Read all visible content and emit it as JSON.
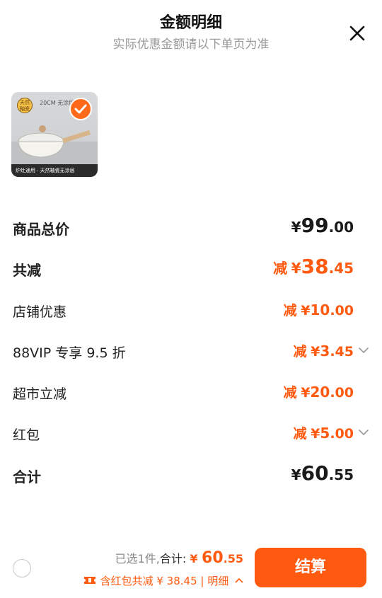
{
  "header": {
    "title": "金额明细",
    "subtitle": "实际优惠金额请以下单页为准"
  },
  "product": {
    "badge_text": "天然釉瓷",
    "size_text": "20CM 无涂层",
    "caption": "炉灶通用 · 天然釉瓷无涂层"
  },
  "rows": [
    {
      "label": "商品总价",
      "prefix": "",
      "currency": "¥",
      "integer": "99",
      "decimal": ".00"
    },
    {
      "label": "共减",
      "prefix": "减",
      "currency": "¥",
      "integer": "38",
      "decimal": ".45"
    },
    {
      "label": "店铺优惠",
      "prefix": "减",
      "currency": "¥",
      "integer": "10",
      "decimal": ".00"
    },
    {
      "label": "88VIP 专享 9.5 折",
      "prefix": "减",
      "currency": "¥",
      "integer": "3",
      "decimal": ".45"
    },
    {
      "label": "超市立减",
      "prefix": "减",
      "currency": "¥",
      "integer": "20",
      "decimal": ".00"
    },
    {
      "label": "红包",
      "prefix": "减",
      "currency": "¥",
      "integer": "5",
      "decimal": ".00"
    },
    {
      "label": "合计",
      "prefix": "",
      "currency": "¥",
      "integer": "60",
      "decimal": ".55"
    }
  ],
  "footer": {
    "selected_text": "已选1件,",
    "total_label": "合计:",
    "currency": "¥",
    "total_integer": "60",
    "total_decimal": ".55",
    "promo_text": "含红包共减 ¥ 38.45 | 明细",
    "checkout_label": "结算"
  },
  "colors": {
    "accent": "#ff5a0f",
    "text": "#222222",
    "muted": "#9a9a9a"
  }
}
